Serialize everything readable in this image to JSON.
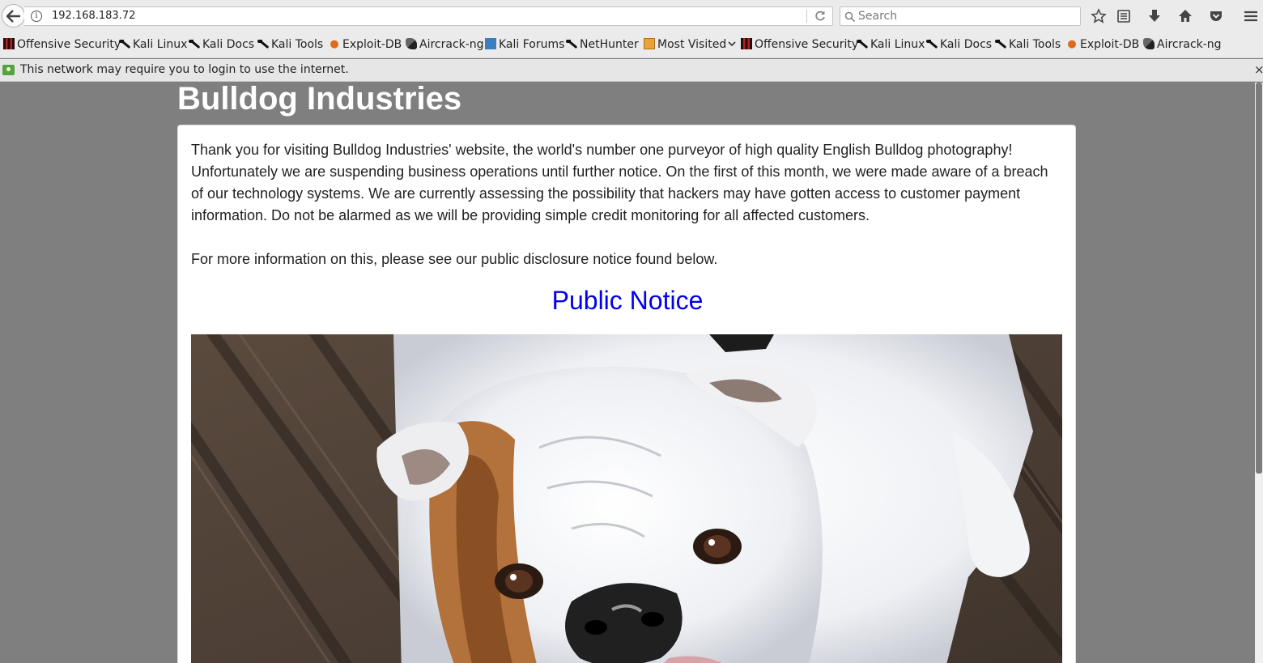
{
  "browser": {
    "url": "192.168.183.72",
    "search_placeholder": "Search"
  },
  "bookmarks": [
    {
      "label": "Offensive Security",
      "icon": "offsec-icon"
    },
    {
      "label": "Kali Linux",
      "icon": "kali-icon"
    },
    {
      "label": "Kali Docs",
      "icon": "kali-icon"
    },
    {
      "label": "Kali Tools",
      "icon": "kali-icon"
    },
    {
      "label": "Exploit-DB",
      "icon": "exploit-db-icon"
    },
    {
      "label": "Aircrack-ng",
      "icon": "aircrack-icon"
    },
    {
      "label": "Kali Forums",
      "icon": "forums-icon"
    },
    {
      "label": "NetHunter",
      "icon": "kali-icon"
    },
    {
      "label": "Most Visited",
      "icon": "folder-icon"
    },
    {
      "label": "Offensive Security",
      "icon": "offsec-icon"
    },
    {
      "label": "Kali Linux",
      "icon": "kali-icon"
    },
    {
      "label": "Kali Docs",
      "icon": "kali-icon"
    },
    {
      "label": "Kali Tools",
      "icon": "kali-icon"
    },
    {
      "label": "Exploit-DB",
      "icon": "exploit-db-icon"
    },
    {
      "label": "Aircrack-ng",
      "icon": "aircrack-icon"
    }
  ],
  "notification": {
    "text": "This network may require you to login to use the internet.",
    "close": "×"
  },
  "page": {
    "title": "Bulldog Industries",
    "paragraph1": "Thank you for visiting Bulldog Industries' website, the world's number one purveyor of high quality English Bulldog photography! Unfortunately we are suspending business operations until further notice. On the first of this month, we were made aware of a breach of our technology systems. We are currently assessing the possibility that hackers may have gotten access to customer payment information. Do not be alarmed as we will be providing simple credit monitoring for all affected customers.",
    "paragraph2": "For more information on this, please see our public disclosure notice found below.",
    "notice_link": "Public Notice"
  },
  "colors": {
    "page_bg": "#7f7f7f",
    "link": "#0000ee",
    "title": "#ffffff"
  }
}
